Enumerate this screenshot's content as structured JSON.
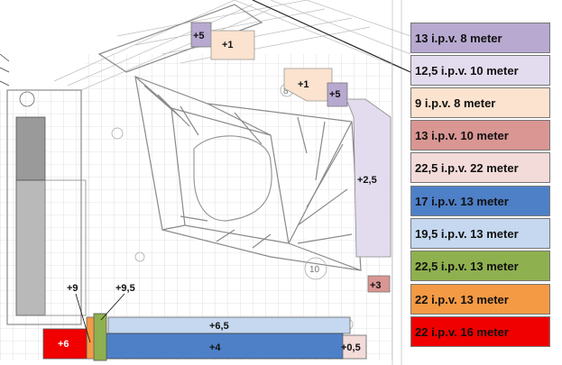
{
  "colors": {
    "purple_dark": "#b7a9d0",
    "lavender": "#e3dcee",
    "peach": "#fbe3cf",
    "rose": "#d99693",
    "pink_light": "#f3dbd9",
    "blue": "#4e80c8",
    "blue_light": "#c5d8f0",
    "green": "#8fb04f",
    "orange": "#f59a44",
    "red": "#f00000"
  },
  "legend": [
    {
      "text": "13 i.p.v. 8 meter",
      "color": "#b7a9d0"
    },
    {
      "text": "12,5 i.p.v. 10 meter",
      "color": "#e3dcee"
    },
    {
      "text": "9 i.p.v. 8 meter",
      "color": "#fbe3cf"
    },
    {
      "text": "13 i.p.v. 10 meter",
      "color": "#d99693"
    },
    {
      "text": "22,5 i.p.v. 22 meter",
      "color": "#f3dbd9"
    },
    {
      "text": "17 i.p.v. 13 meter",
      "color": "#4e80c8"
    },
    {
      "text": "19,5 i.p.v. 13 meter",
      "color": "#c5d8f0"
    },
    {
      "text": "22,5 i.p.v. 13 meter",
      "color": "#8fb04f"
    },
    {
      "text": "22 i.p.v. 13 meter",
      "color": "#f59a44"
    },
    {
      "text": "22 i.p.v. 16 meter",
      "color": "#f00000"
    }
  ],
  "plan_labels": {
    "top_purple": "+5",
    "top_peach": "+1",
    "mid_peach": "+1",
    "mid_purple": "+5",
    "lavender_strip": "+2,5",
    "rose_small": "+3",
    "green_label": "+9,5",
    "orange_label": "+9",
    "blue_light_label": "+6,5",
    "blue_label": "+4",
    "red_label": "+6",
    "pink_label": "+0,5"
  },
  "background_marks": {
    "number_8": "8",
    "number_10": "10"
  }
}
